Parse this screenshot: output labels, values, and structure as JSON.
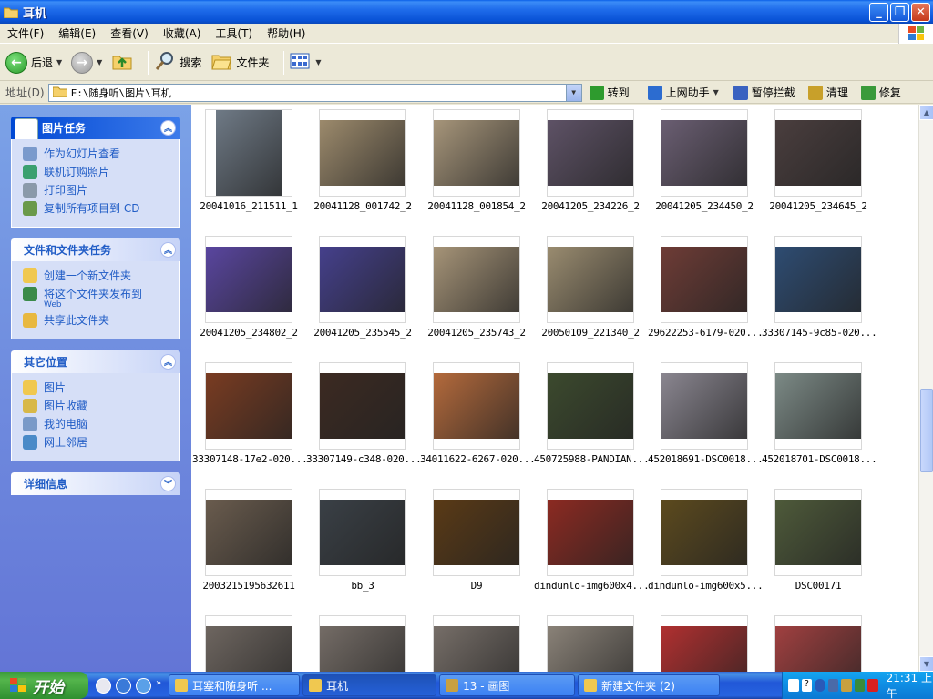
{
  "window": {
    "title": "耳机"
  },
  "menu": [
    "文件(F)",
    "编辑(E)",
    "查看(V)",
    "收藏(A)",
    "工具(T)",
    "帮助(H)"
  ],
  "toolbar": {
    "back": "后退",
    "search": "搜索",
    "folders": "文件夹"
  },
  "address": {
    "label": "地址(D)",
    "path": "F:\\随身听\\图片\\耳机",
    "go": "转到",
    "helper": "上网助手",
    "block": "暂停拦截",
    "clean": "清理",
    "repair": "修复"
  },
  "left": {
    "picture_tasks": {
      "title": "图片任务",
      "items": [
        "作为幻灯片查看",
        "联机订购照片",
        "打印图片",
        "复制所有项目到 CD"
      ]
    },
    "file_tasks": {
      "title": "文件和文件夹任务",
      "items": [
        "创建一个新文件夹",
        "将这个文件夹发布到",
        "共享此文件夹"
      ],
      "publish_sub": "Web"
    },
    "other_places": {
      "title": "其它位置",
      "items": [
        "图片",
        "图片收藏",
        "我的电脑",
        "网上邻居"
      ]
    },
    "details": {
      "title": "详细信息"
    }
  },
  "files": [
    {
      "name": "20041016_211511_1",
      "color": "#6F7A86"
    },
    {
      "name": "20041128_001742_2",
      "color": "#9C8A6C"
    },
    {
      "name": "20041128_001854_2",
      "color": "#A6957A"
    },
    {
      "name": "20041205_234226_2",
      "color": "#5E5266"
    },
    {
      "name": "20041205_234450_2",
      "color": "#6A5E72"
    },
    {
      "name": "20041205_234645_2",
      "color": "#4A3E3E"
    },
    {
      "name": "20041205_234802_2",
      "color": "#5A46A0"
    },
    {
      "name": "20041205_235545_2",
      "color": "#45408C"
    },
    {
      "name": "20041205_235743_2",
      "color": "#A69478"
    },
    {
      "name": "20050109_221340_2",
      "color": "#9A8C70"
    },
    {
      "name": "29622253-6179-020...",
      "color": "#6E3C36"
    },
    {
      "name": "33307145-9c85-020...",
      "color": "#2E4C72"
    },
    {
      "name": "33307148-17e2-020...",
      "color": "#7A3C22"
    },
    {
      "name": "33307149-c348-020...",
      "color": "#3C2A22"
    },
    {
      "name": "34011622-6267-020...",
      "color": "#B46A3C"
    },
    {
      "name": "450725988-PANDIAN...",
      "color": "#3C4A2E"
    },
    {
      "name": "452018691-DSC0018...",
      "color": "#8A8690"
    },
    {
      "name": "452018701-DSC0018...",
      "color": "#7C8A86"
    },
    {
      "name": "2003215195632611",
      "color": "#6A5C4E"
    },
    {
      "name": "bb_3",
      "color": "#3A4046"
    },
    {
      "name": "D9",
      "color": "#5A3A16"
    },
    {
      "name": "dindunlo-img600x4...",
      "color": "#8C2A22"
    },
    {
      "name": "dindunlo-img600x5...",
      "color": "#5C4A1E"
    },
    {
      "name": "DSC00171",
      "color": "#4E5A3A"
    },
    {
      "name": "",
      "color": "#6E6660"
    },
    {
      "name": "",
      "color": "#746C66"
    },
    {
      "name": "",
      "color": "#766E68"
    },
    {
      "name": "",
      "color": "#8A8278"
    },
    {
      "name": "",
      "color": "#B03030"
    },
    {
      "name": "",
      "color": "#A04040"
    }
  ],
  "taskbar": {
    "start": "开始",
    "buttons": [
      {
        "label": "耳塞和随身听 ...",
        "active": false
      },
      {
        "label": "耳机",
        "active": true
      },
      {
        "label": "13 - 画图",
        "active": false
      },
      {
        "label": "新建文件夹 (2)",
        "active": false
      }
    ],
    "clock": "21:31 上午"
  }
}
